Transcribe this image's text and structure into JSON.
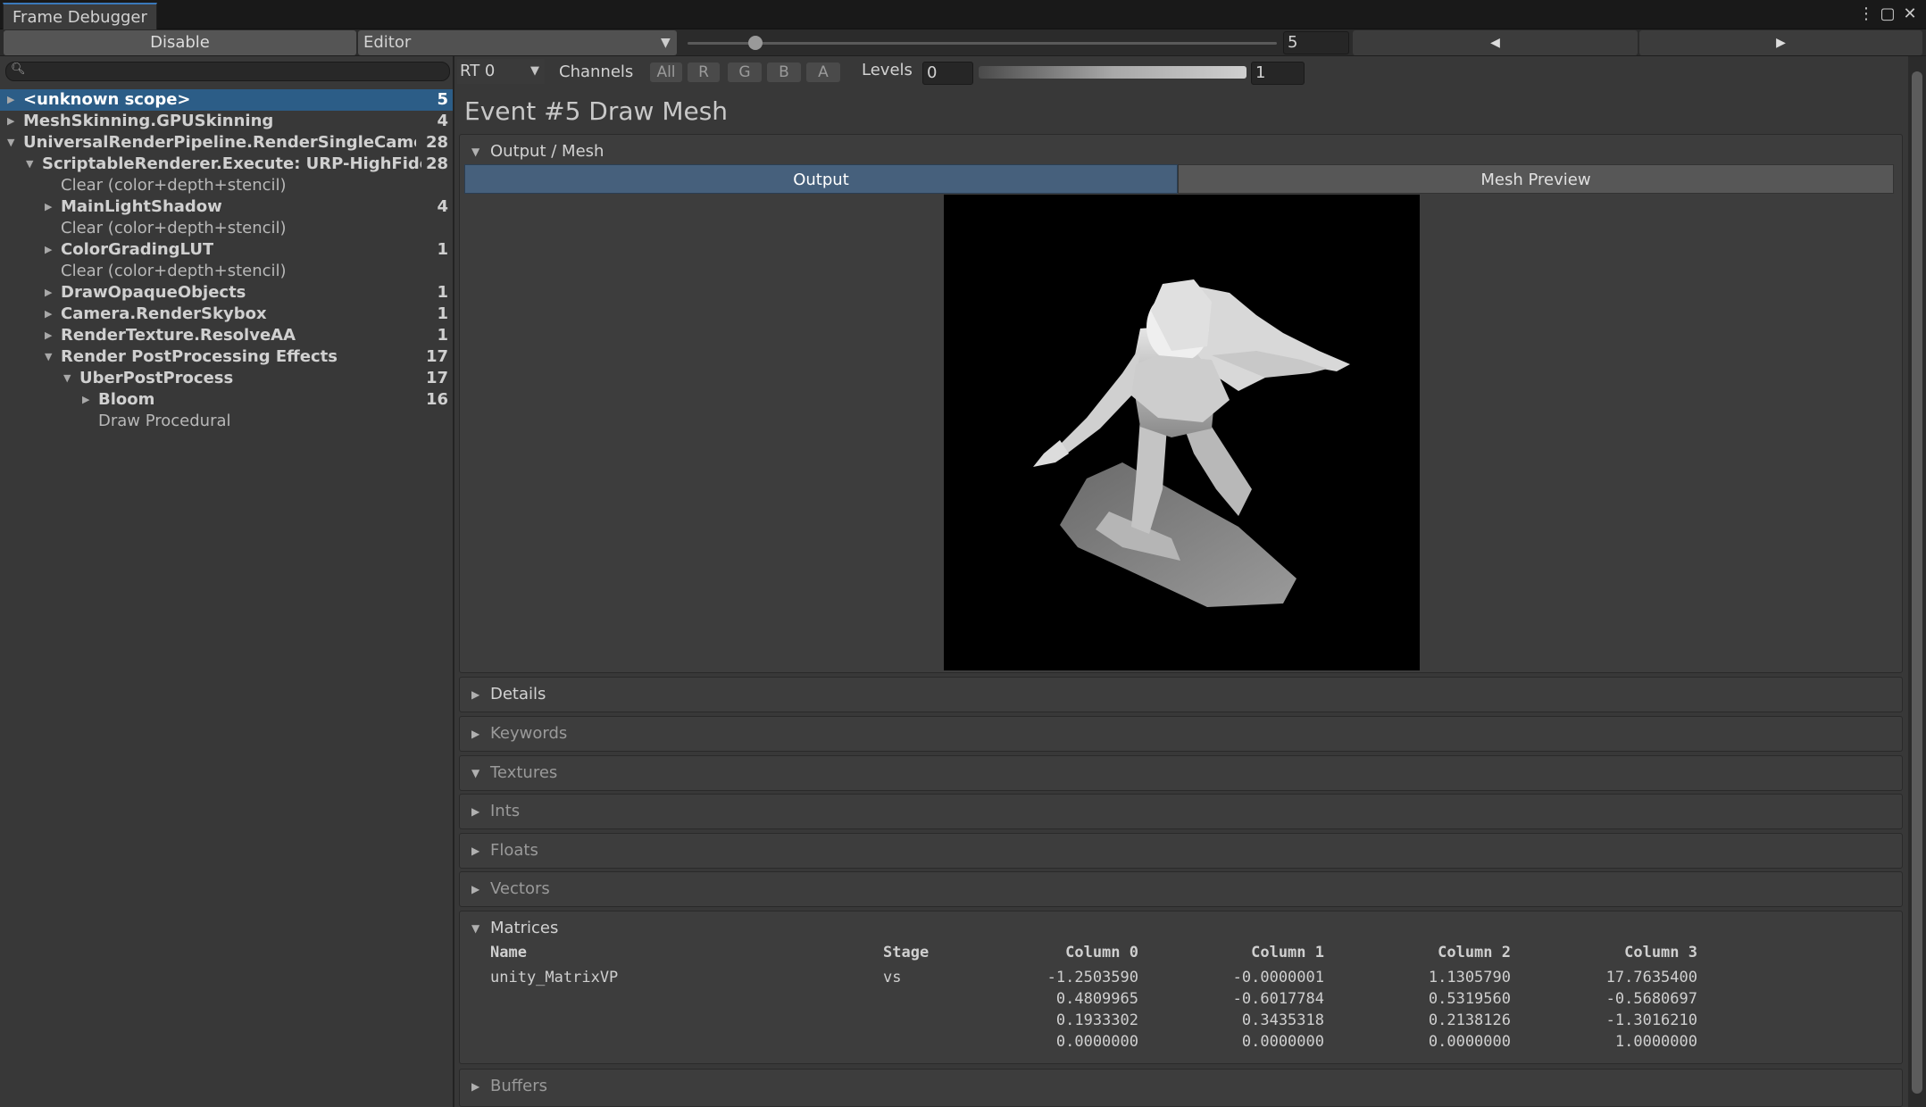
{
  "window": {
    "tab_title": "Frame Debugger",
    "menu_icon": "kebab-menu-icon",
    "maximize_icon": "maximize-icon",
    "close_icon": "close-icon"
  },
  "toolbar": {
    "disable_label": "Disable",
    "target_label": "Editor",
    "event_index": "5",
    "prev_glyph": "◀",
    "next_glyph": "▶"
  },
  "tree": {
    "rows": [
      {
        "label": "<unknown scope>",
        "count": "5",
        "selected": true,
        "expanded": false
      },
      {
        "label": "MeshSkinning.GPUSkinning",
        "count": "4",
        "expanded": false
      },
      {
        "label": "UniversalRenderPipeline.RenderSingleCameraInte",
        "count": "28",
        "expanded": true
      },
      {
        "label": "ScriptableRenderer.Execute: URP-HighFidelity-",
        "count": "28",
        "expanded": true
      },
      {
        "label": "Clear (color+depth+stencil)",
        "count": ""
      },
      {
        "label": "MainLightShadow",
        "count": "4",
        "expanded": false
      },
      {
        "label": "Clear (color+depth+stencil)",
        "count": ""
      },
      {
        "label": "ColorGradingLUT",
        "count": "1",
        "expanded": false
      },
      {
        "label": "Clear (color+depth+stencil)",
        "count": ""
      },
      {
        "label": "DrawOpaqueObjects",
        "count": "1",
        "expanded": false
      },
      {
        "label": "Camera.RenderSkybox",
        "count": "1",
        "expanded": false
      },
      {
        "label": "RenderTexture.ResolveAA",
        "count": "1",
        "expanded": false
      },
      {
        "label": "Render PostProcessing Effects",
        "count": "17",
        "expanded": true
      },
      {
        "label": "UberPostProcess",
        "count": "17",
        "expanded": true
      },
      {
        "label": "Bloom",
        "count": "16",
        "expanded": false
      },
      {
        "label": "Draw Procedural",
        "count": ""
      }
    ]
  },
  "viewer": {
    "rt_label": "RT 0",
    "channels_label": "Channels",
    "channels": [
      "All",
      "R",
      "G",
      "B",
      "A"
    ],
    "levels_label": "Levels",
    "levels_min": "0",
    "levels_max": "1",
    "event_title": "Event #5 Draw Mesh"
  },
  "output_section": {
    "title": "Output / Mesh",
    "tabs": [
      "Output",
      "Mesh Preview"
    ],
    "active_tab": "Output"
  },
  "sections": {
    "details": "Details",
    "keywords": "Keywords",
    "textures": "Textures",
    "ints": "Ints",
    "floats": "Floats",
    "vectors": "Vectors",
    "matrices": "Matrices",
    "buffers": "Buffers"
  },
  "matrices": {
    "headers": [
      "Name",
      "Stage",
      "Column 0",
      "Column 1",
      "Column 2",
      "Column 3"
    ],
    "name": "unity_MatrixVP",
    "stage": "vs",
    "rows": [
      [
        "-1.2503590",
        "-0.0000001",
        "1.1305790",
        "17.7635400"
      ],
      [
        "0.4809965",
        "-0.6017784",
        "0.5319560",
        "-0.5680697"
      ],
      [
        "0.1933302",
        "0.3435318",
        "0.2138126",
        "-1.3016210"
      ],
      [
        "0.0000000",
        "0.0000000",
        "0.0000000",
        "1.0000000"
      ]
    ]
  }
}
